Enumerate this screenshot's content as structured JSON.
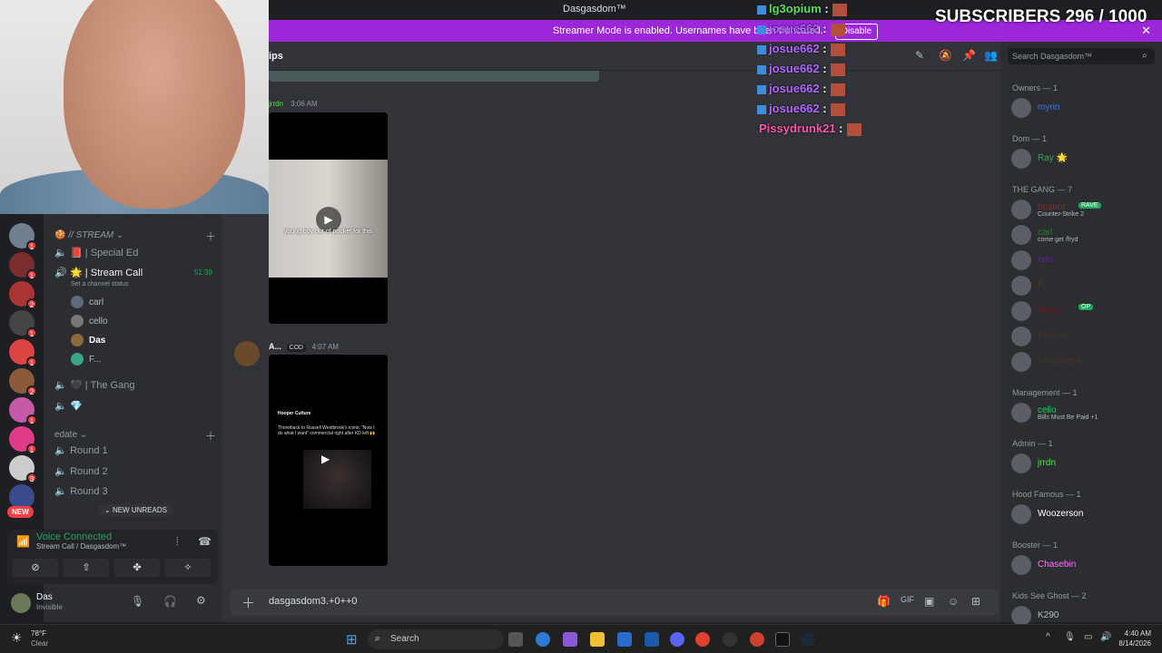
{
  "window": {
    "title": "Dasgasdom™"
  },
  "banner": {
    "text": "Streamer Mode is enabled. Usernames have been truncated.",
    "button": "Disable"
  },
  "overlay": {
    "subscribers": "SUBSCRIBERS 296 / 1000",
    "chat": [
      {
        "user": "lg3opium",
        "color": "#55e055"
      },
      {
        "user": "josue662",
        "color": "#b366ff"
      },
      {
        "user": "josue662",
        "color": "#b366ff"
      },
      {
        "user": "josue662",
        "color": "#b366ff"
      },
      {
        "user": "josue662",
        "color": "#b366ff"
      },
      {
        "user": "josue662",
        "color": "#b366ff"
      },
      {
        "user": "Pissydrunk21",
        "color": "#ff55aa"
      }
    ]
  },
  "channel_header": {
    "name": "ips"
  },
  "channels": {
    "category1": "// STREAM",
    "items": [
      {
        "name": "Special Ed"
      },
      {
        "name": "Stream Call",
        "time": "51:39",
        "status": "Set a channel status"
      }
    ],
    "voice_users": [
      "carl",
      "cello",
      "Das",
      "F..."
    ],
    "gang": "The Gang",
    "category2": "edate",
    "rounds": [
      "Round 1",
      "Round 2",
      "Round 3"
    ],
    "new_unreads": "NEW UNREADS"
  },
  "servers": {
    "new_label": "NEW"
  },
  "voice": {
    "status": "Voice Connected",
    "sub": "Stream Call / Dasgasdom™"
  },
  "user": {
    "name": "Das",
    "status": "Invisible"
  },
  "messages": [
    {
      "author": "jrrdn",
      "time": "3:06 AM",
      "caption": "young boy out of pocket for this"
    },
    {
      "author": "A...",
      "tag": "COD",
      "time": "4:07 AM",
      "card_title": "Hooper Culture",
      "card_text": "Throwback to Russell Westbrook's iconic \"Now I do what I want\" commercial right after KD left 🙌"
    }
  ],
  "input": {
    "value": "dasgasdom3.+0++0"
  },
  "search": {
    "placeholder": "Search Dasgasdom™"
  },
  "members": [
    {
      "cat": "Owners — 1",
      "list": [
        {
          "name": "myrin",
          "color": "#3c78dc"
        }
      ]
    },
    {
      "cat": "Dom — 1",
      "list": [
        {
          "name": "Ray 🌟",
          "color": "#3ba55c"
        }
      ]
    },
    {
      "cat": "THE GANG — 7",
      "list": [
        {
          "name": "bcanor",
          "color": "#8a2b2b",
          "activity": "Counter-Strike 2",
          "tag": "RAVE"
        },
        {
          "name": "carl",
          "color": "#2e7d32",
          "activity": "come get /fryd"
        },
        {
          "name": "edo",
          "color": "#6a1b9a"
        },
        {
          "name": "F...",
          "color": "#5b3a1f"
        },
        {
          "name": "Flesh",
          "color": "#6a1b1b",
          "tag": "OP"
        },
        {
          "name": "Kenicky",
          "color": "#4a3322"
        },
        {
          "name": "whoisfresh",
          "color": "#4a3322"
        }
      ]
    },
    {
      "cat": "Management — 1",
      "list": [
        {
          "name": "cello",
          "color": "#23d160",
          "activity": "Bills Must Be Paid +1"
        }
      ]
    },
    {
      "cat": "Admin — 1",
      "list": [
        {
          "name": "jrrdn",
          "color": "#55e055"
        }
      ]
    },
    {
      "cat": "Hood Famous — 1",
      "list": [
        {
          "name": "Woozerson",
          "color": "#ffffff"
        }
      ]
    },
    {
      "cat": "Booster — 1",
      "list": [
        {
          "name": "Chasebin",
          "color": "#ff73fa"
        }
      ]
    },
    {
      "cat": "Kids See Ghost — 2",
      "list": [
        {
          "name": "K290",
          "color": "#b5bac1"
        }
      ]
    }
  ],
  "taskbar": {
    "weather_temp": "78°F",
    "weather_desc": "Clear",
    "search": "Search",
    "time": "4:40 AM",
    "date": "8/14/2026"
  }
}
